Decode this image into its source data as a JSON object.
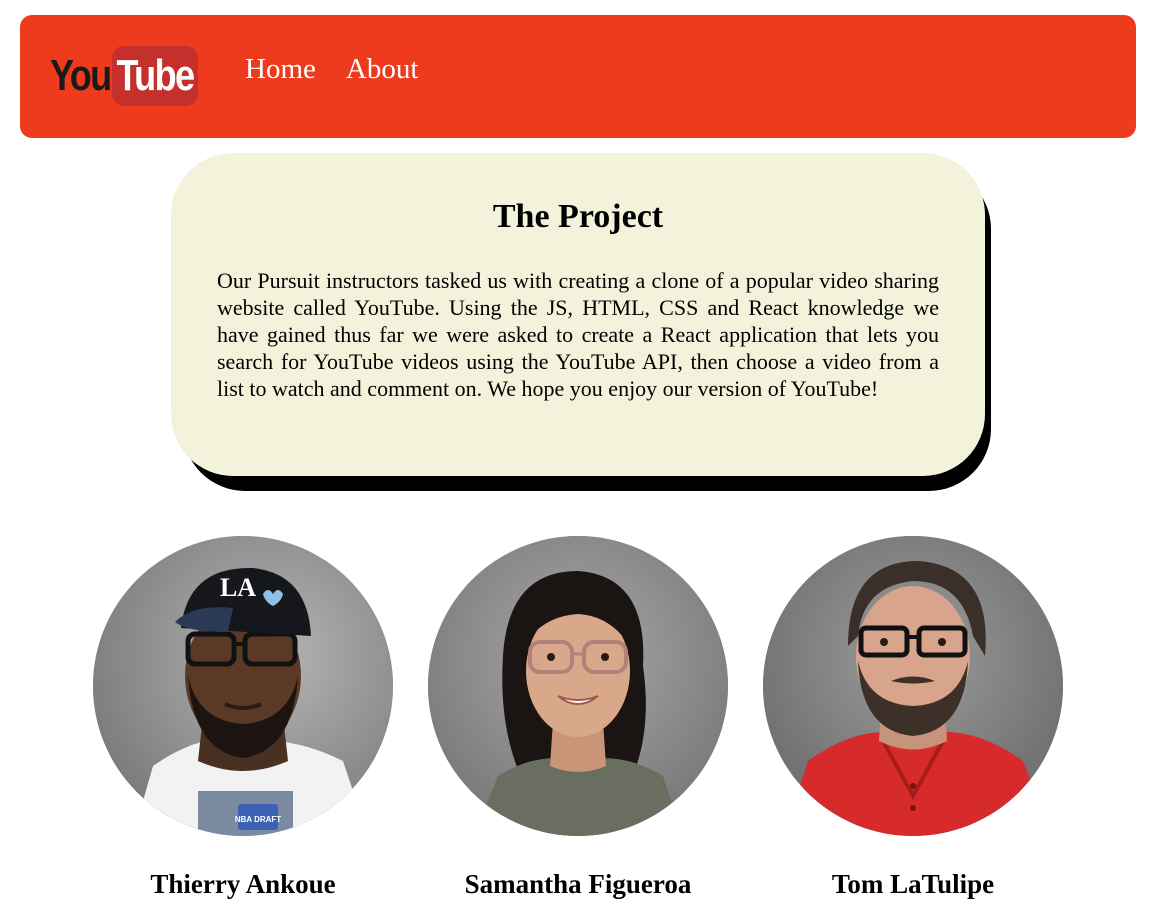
{
  "navbar": {
    "logo": {
      "you": "You",
      "tube": "Tube"
    },
    "links": [
      {
        "label": "Home"
      },
      {
        "label": "About"
      }
    ]
  },
  "project": {
    "title": "The Project",
    "text": "Our Pursuit instructors tasked us with creating a clone of a popular video sharing website called YouTube. Using the JS, HTML, CSS and React knowledge we have gained thus far we were asked to create a React application that lets you search for YouTube videos using the YouTube API, then choose a video from a list to watch and comment on. We hope you enjoy our version of YouTube!"
  },
  "team": {
    "members": [
      {
        "name": "Thierry Ankoue",
        "cap_text": "LA",
        "shirt_text": "NBA DRAFT"
      },
      {
        "name": "Samantha Figueroa"
      },
      {
        "name": "Tom LaTulipe"
      }
    ]
  },
  "colors": {
    "navbar": "#ee3b1e",
    "card": "#f3f3dc",
    "card_shadow": "#000000"
  }
}
